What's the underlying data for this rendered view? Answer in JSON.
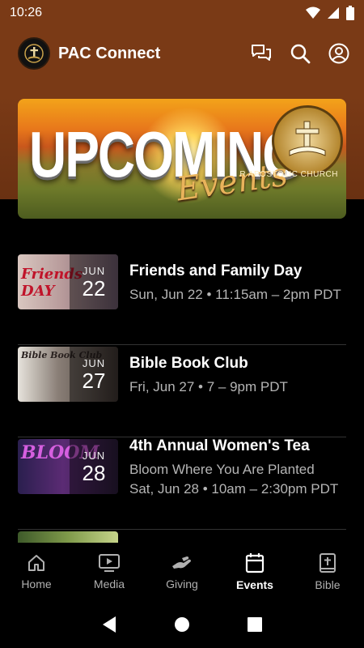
{
  "status": {
    "time": "10:26"
  },
  "app": {
    "title": "PAC Connect"
  },
  "banner": {
    "headline": "UPCOMING",
    "script": "Events",
    "seal_text": "R APOSTOLIC CHURCH"
  },
  "events": [
    {
      "month": "JUN",
      "day": "22",
      "title": "Friends and Family Day",
      "subtitle": "Sun, Jun 22 • 11:15am – 2pm PDT",
      "detail": "",
      "thumb_text": "Friends DAY"
    },
    {
      "month": "JUN",
      "day": "27",
      "title": "Bible Book Club",
      "subtitle": "Fri, Jun 27 • 7 – 9pm PDT",
      "detail": "",
      "thumb_text": "Bible Book Club"
    },
    {
      "month": "JUN",
      "day": "28",
      "title": "4th Annual Women's Tea",
      "subtitle": "Bloom Where You Are Planted",
      "detail": "Sat, Jun 28 • 10am – 2:30pm PDT",
      "thumb_text": "BLOOM"
    }
  ],
  "tabs": [
    {
      "label": "Home",
      "icon": "home-icon"
    },
    {
      "label": "Media",
      "icon": "media-icon"
    },
    {
      "label": "Giving",
      "icon": "giving-icon"
    },
    {
      "label": "Events",
      "icon": "calendar-icon",
      "active": true
    },
    {
      "label": "Bible",
      "icon": "bible-icon"
    }
  ],
  "colors": {
    "header": "#7a3a16",
    "background": "#000000",
    "active_tab": "#ffffff",
    "inactive_tab": "#b0b0b0"
  }
}
